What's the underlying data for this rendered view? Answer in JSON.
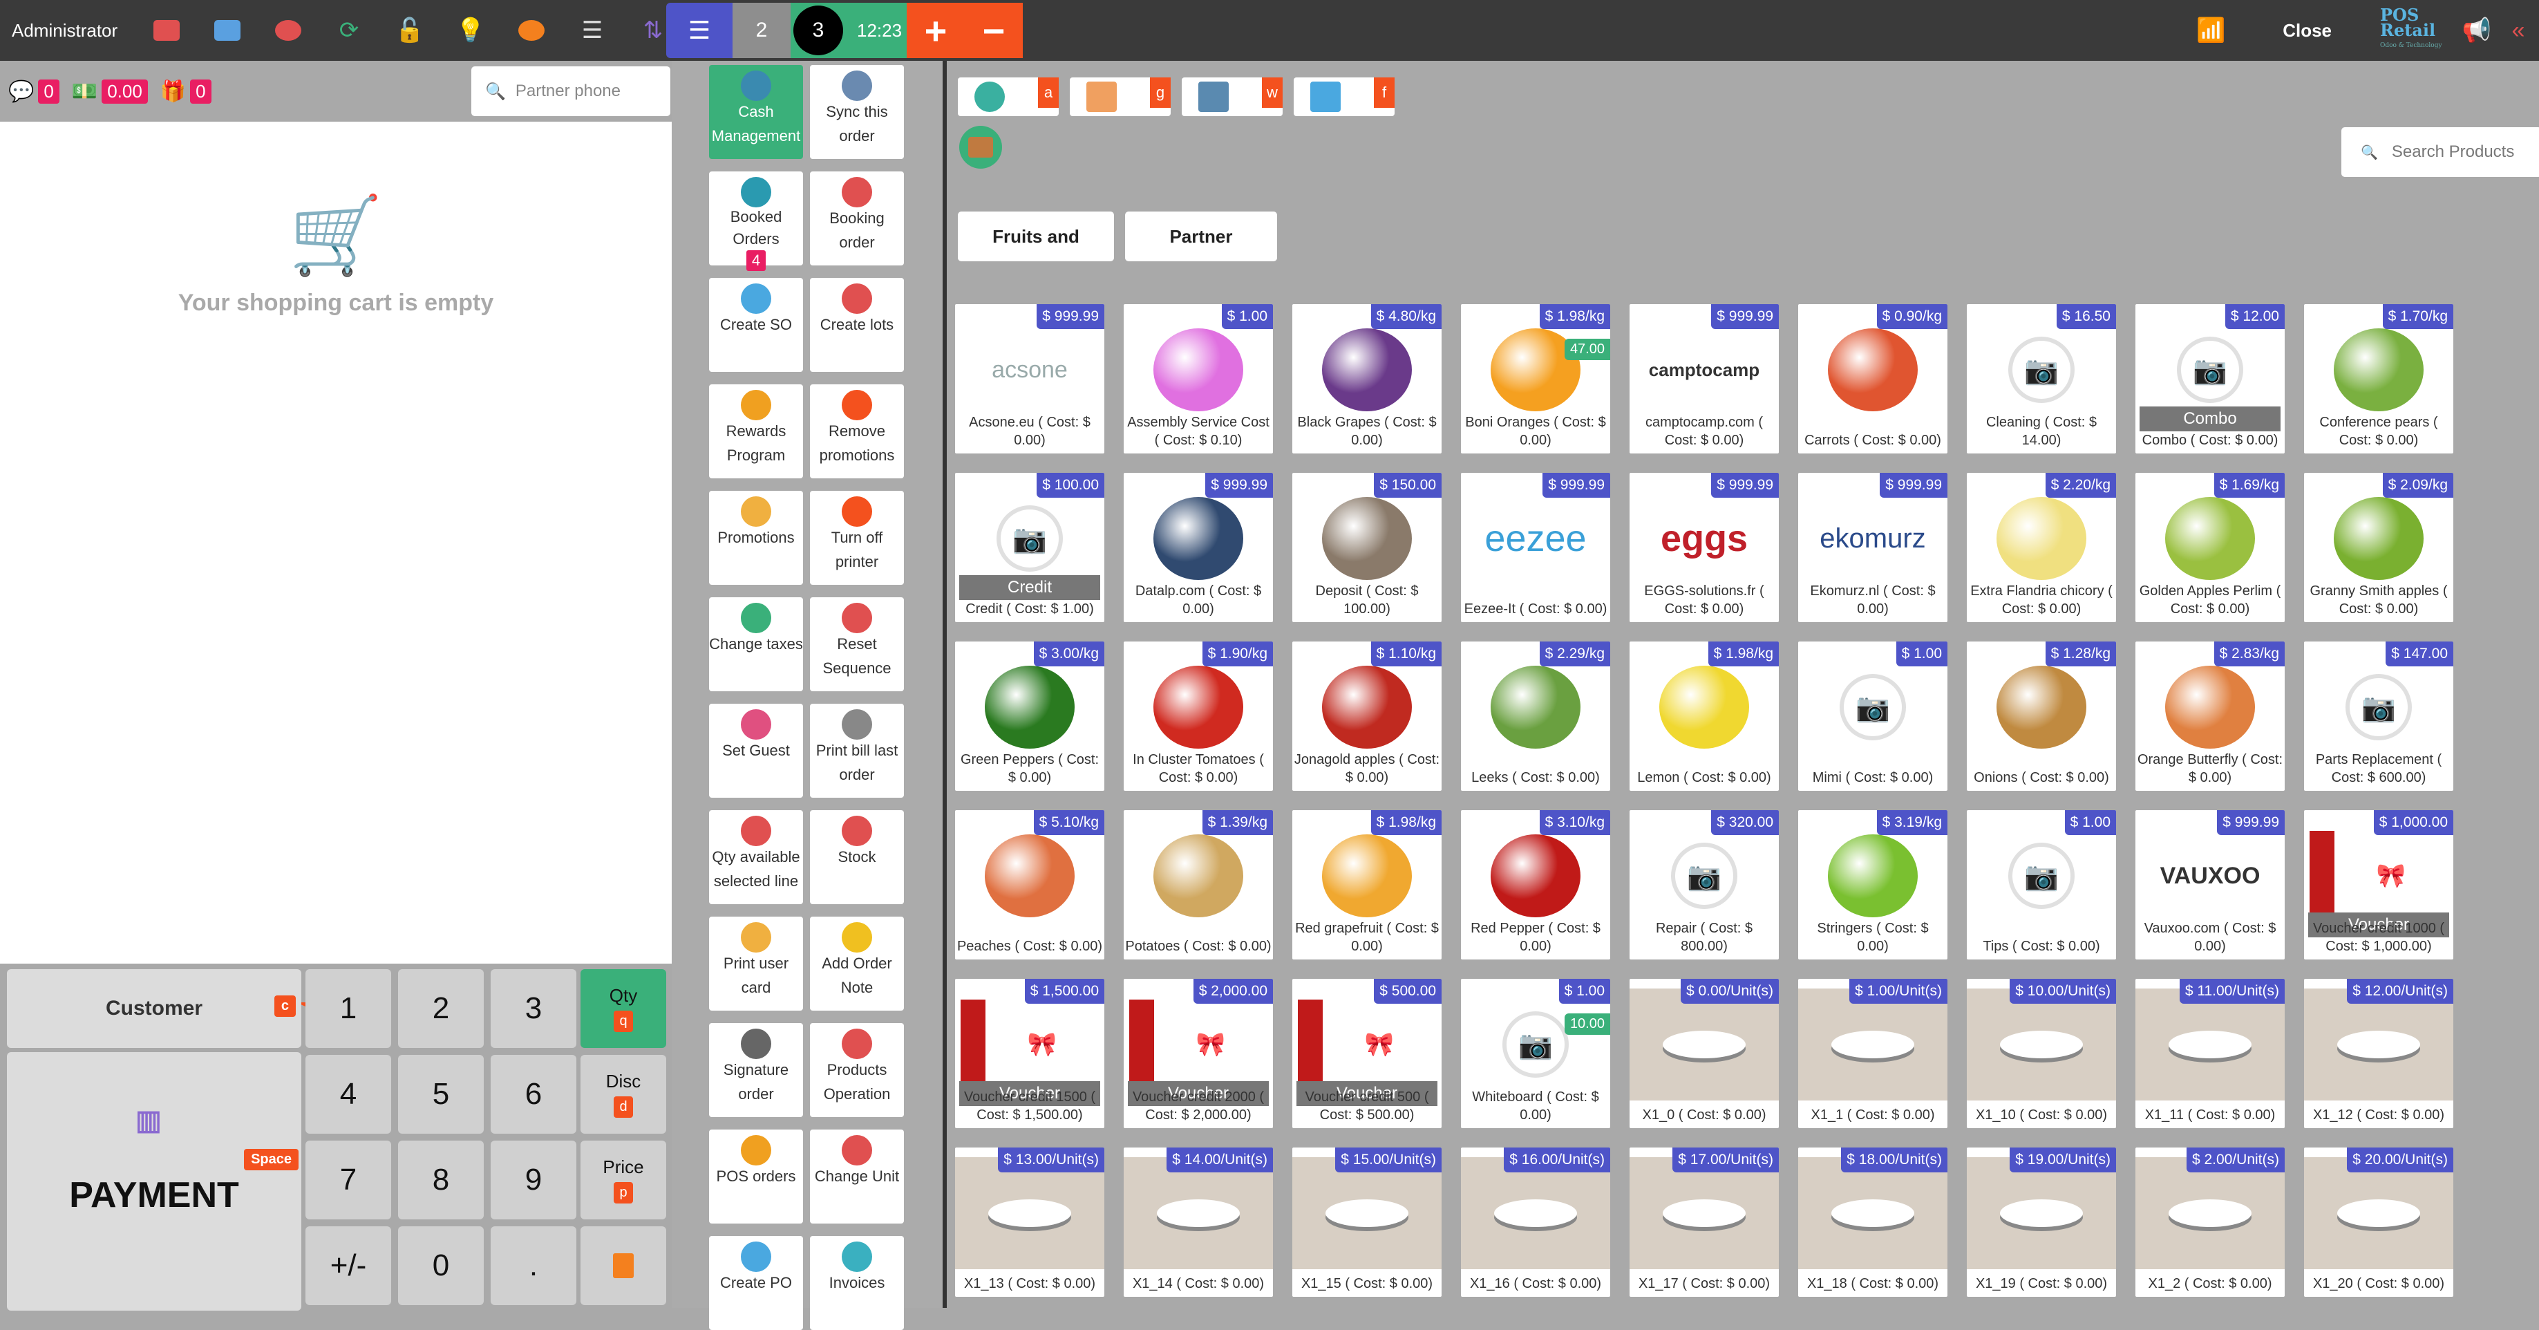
{
  "topbar": {
    "user": "Administrator",
    "orders": {
      "other": "2",
      "current": "3",
      "time": "12:23",
      "add": "+",
      "remove": "−"
    },
    "close": "Close",
    "logo": "POS Retail",
    "logo_sub": "Odoo & Technology"
  },
  "left": {
    "chat_count": "0",
    "cash": "0.00",
    "gift_count": "0",
    "partner_placeholder": "Partner phone",
    "empty_text": "Your shopping cart is empty"
  },
  "pad": {
    "customer": "Customer",
    "customer_key": "c",
    "payment": "PAYMENT",
    "payment_key": "Space",
    "keys": [
      "1",
      "2",
      "3",
      "4",
      "5",
      "6",
      "7",
      "8",
      "9",
      "+/-",
      "0",
      "."
    ],
    "qty": "Qty",
    "qty_key": "q",
    "disc": "Disc",
    "disc_key": "d",
    "price": "Price",
    "price_key": "p"
  },
  "actions": [
    {
      "label": "Cash Management",
      "name": "cash-management-button",
      "icon": "#3a8ab0"
    },
    {
      "label": "Sync this order",
      "name": "sync-order-button",
      "icon": "#6a8ab0"
    },
    {
      "label": "Booked Orders",
      "badge": "4",
      "name": "booked-orders-button",
      "icon": "#2a9ab0"
    },
    {
      "label": "Booking order",
      "name": "booking-order-button",
      "icon": "#e05050"
    },
    {
      "label": "Create SO",
      "name": "create-so-button",
      "icon": "#4aa8e0"
    },
    {
      "label": "Create lots",
      "name": "create-lots-button",
      "icon": "#e05050"
    },
    {
      "label": "Rewards Program",
      "name": "rewards-program-button",
      "icon": "#f0a020"
    },
    {
      "label": "Remove promotions",
      "name": "remove-promotions-button",
      "icon": "#f4511e"
    },
    {
      "label": "Promotions",
      "name": "promotions-button",
      "icon": "#f0b040"
    },
    {
      "label": "Turn off printer",
      "name": "turn-off-printer-button",
      "icon": "#f4511e"
    },
    {
      "label": "Change taxes",
      "name": "change-taxes-button",
      "icon": "#3ab07a"
    },
    {
      "label": "Reset Sequence",
      "name": "reset-sequence-button",
      "icon": "#e05050"
    },
    {
      "label": "Set Guest",
      "name": "set-guest-button",
      "icon": "#e05080"
    },
    {
      "label": "Print bill last order",
      "name": "print-bill-button",
      "icon": "#888888"
    },
    {
      "label": "Qty available selected line",
      "name": "qty-available-button",
      "icon": "#e05050"
    },
    {
      "label": "Stock",
      "name": "stock-button",
      "icon": "#e05050"
    },
    {
      "label": "Print user card",
      "name": "print-user-card-button",
      "icon": "#f0b040"
    },
    {
      "label": "Add Order Note",
      "name": "add-order-note-button",
      "icon": "#f0c020"
    },
    {
      "label": "Signature order",
      "name": "signature-order-button",
      "icon": "#666666"
    },
    {
      "label": "Products Operation",
      "name": "products-operation-button",
      "icon": "#e05050"
    },
    {
      "label": "POS orders",
      "name": "pos-orders-button",
      "icon": "#f0a020"
    },
    {
      "label": "Change Unit",
      "name": "change-unit-button",
      "icon": "#e05050"
    },
    {
      "label": "Create PO",
      "name": "create-po-button",
      "icon": "#4aa8e0"
    },
    {
      "label": "Invoices",
      "name": "invoices-button",
      "icon": "#3ab0c0"
    }
  ],
  "right": {
    "cat_letters": [
      "a",
      "g",
      "w",
      "f"
    ],
    "search_placeholder": "Search Products",
    "categories": [
      "Fruits and",
      "Partner"
    ]
  },
  "products": [
    {
      "price": "$ 999.99",
      "name": "Acsone.eu ( Cost: $ 0.00)",
      "img": "text:acsone"
    },
    {
      "price": "$ 1.00",
      "name": "Assembly Service Cost ( Cost: $ 0.10)",
      "img": "#e070e0"
    },
    {
      "price": "$ 4.80/kg",
      "name": "Black Grapes ( Cost: $ 0.00)",
      "img": "#6a3a8a"
    },
    {
      "price": "$ 1.98/kg",
      "stock": "47.00",
      "name": "Boni Oranges ( Cost: $ 0.00)",
      "img": "#f5a020"
    },
    {
      "price": "$ 999.99",
      "name": "camptocamp.com ( Cost: $ 0.00)",
      "img": "text:camptocamp"
    },
    {
      "price": "$ 0.90/kg",
      "name": "Carrots ( Cost: $ 0.00)",
      "img": "#e05530"
    },
    {
      "price": "$ 16.50",
      "name": "Cleaning ( Cost: $ 14.00)",
      "img": "none"
    },
    {
      "price": "$ 12.00",
      "name": "Combo ( Cost: $ 0.00)",
      "img": "none",
      "overlay": "Combo"
    },
    {
      "price": "$ 1.70/kg",
      "name": "Conference pears ( Cost: $ 0.00)",
      "img": "#7ab040"
    },
    {
      "price": "$ 100.00",
      "name": "Credit ( Cost: $ 1.00)",
      "img": "none",
      "overlay": "Credit"
    },
    {
      "price": "$ 999.99",
      "name": "Datalp.com ( Cost: $ 0.00)",
      "img": "#304a70"
    },
    {
      "price": "$ 150.00",
      "name": "Deposit ( Cost: $ 100.00)",
      "img": "#8a7a6a"
    },
    {
      "price": "$ 999.99",
      "name": "Eezee-It ( Cost: $ 0.00)",
      "img": "text:eezee"
    },
    {
      "price": "$ 999.99",
      "name": "EGGS-solutions.fr ( Cost: $ 0.00)",
      "img": "text:eggs"
    },
    {
      "price": "$ 999.99",
      "name": "Ekomurz.nl ( Cost: $ 0.00)",
      "img": "text:ekomurz"
    },
    {
      "price": "$ 2.20/kg",
      "name": "Extra Flandria chicory ( Cost: $ 0.00)",
      "img": "#f0e080"
    },
    {
      "price": "$ 1.69/kg",
      "name": "Golden Apples Perlim ( Cost: $ 0.00)",
      "img": "#9ac040"
    },
    {
      "price": "$ 2.09/kg",
      "name": "Granny Smith apples ( Cost: $ 0.00)",
      "img": "#7ab030"
    },
    {
      "price": "$ 3.00/kg",
      "name": "Green Peppers ( Cost: $ 0.00)",
      "img": "#2a7a20"
    },
    {
      "price": "$ 1.90/kg",
      "name": "In Cluster Tomatoes ( Cost: $ 0.00)",
      "img": "#d02a20"
    },
    {
      "price": "$ 1.10/kg",
      "name": "Jonagold apples ( Cost: $ 0.00)",
      "img": "#c02a20"
    },
    {
      "price": "$ 2.29/kg",
      "name": "Leeks ( Cost: $ 0.00)",
      "img": "#6aa040"
    },
    {
      "price": "$ 1.98/kg",
      "name": "Lemon ( Cost: $ 0.00)",
      "img": "#f0d830"
    },
    {
      "price": "$ 1.00",
      "name": "Mimi ( Cost: $ 0.00)",
      "img": "none"
    },
    {
      "price": "$ 1.28/kg",
      "name": "Onions ( Cost: $ 0.00)",
      "img": "#c08a40"
    },
    {
      "price": "$ 2.83/kg",
      "name": "Orange Butterfly ( Cost: $ 0.00)",
      "img": "#e08040"
    },
    {
      "price": "$ 147.00",
      "name": "Parts Replacement ( Cost: $ 600.00)",
      "img": "none"
    },
    {
      "price": "$ 5.10/kg",
      "name": "Peaches ( Cost: $ 0.00)",
      "img": "#e07040"
    },
    {
      "price": "$ 1.39/kg",
      "name": "Potatoes ( Cost: $ 0.00)",
      "img": "#d0a860"
    },
    {
      "price": "$ 1.98/kg",
      "name": "Red grapefruit ( Cost: $ 0.00)",
      "img": "#f0a830"
    },
    {
      "price": "$ 3.10/kg",
      "name": "Red Pepper ( Cost: $ 0.00)",
      "img": "#c01a18"
    },
    {
      "price": "$ 320.00",
      "name": "Repair ( Cost: $ 800.00)",
      "img": "none"
    },
    {
      "price": "$ 3.19/kg",
      "name": "Stringers ( Cost: $ 0.00)",
      "img": "#7ac030"
    },
    {
      "price": "$ 1.00",
      "name": "Tips ( Cost: $ 0.00)",
      "img": "none"
    },
    {
      "price": "$ 999.99",
      "name": "Vauxoo.com ( Cost: $ 0.00)",
      "img": "text:vauxoo"
    },
    {
      "price": "$ 1,000.00",
      "name": "Voucher credit 1000 ( Cost: $ 1,000.00)",
      "img": "gift",
      "overlay": "Voucher"
    },
    {
      "price": "$ 1,500.00",
      "name": "Voucher credit 1500 ( Cost: $ 1,500.00)",
      "img": "gift",
      "overlay": "Voucher"
    },
    {
      "price": "$ 2,000.00",
      "name": "Voucher credit 2000 ( Cost: $ 2,000.00)",
      "img": "gift",
      "overlay": "Voucher"
    },
    {
      "price": "$ 500.00",
      "name": "Voucher credit 500 ( Cost: $ 500.00)",
      "img": "gift",
      "overlay": "Voucher"
    },
    {
      "price": "$ 1.00",
      "stock": "10.00",
      "name": "Whiteboard ( Cost: $ 0.00)",
      "img": "none"
    },
    {
      "price": "$ 0.00/Unit(s)",
      "name": "X1_0 ( Cost: $ 0.00)",
      "img": "robot"
    },
    {
      "price": "$ 1.00/Unit(s)",
      "name": "X1_1 ( Cost: $ 0.00)",
      "img": "robot"
    },
    {
      "price": "$ 10.00/Unit(s)",
      "name": "X1_10 ( Cost: $ 0.00)",
      "img": "robot"
    },
    {
      "price": "$ 11.00/Unit(s)",
      "name": "X1_11 ( Cost: $ 0.00)",
      "img": "robot"
    },
    {
      "price": "$ 12.00/Unit(s)",
      "name": "X1_12 ( Cost: $ 0.00)",
      "img": "robot"
    },
    {
      "price": "$ 13.00/Unit(s)",
      "name": "X1_13 ( Cost: $ 0.00)",
      "img": "robot"
    },
    {
      "price": "$ 14.00/Unit(s)",
      "name": "X1_14 ( Cost: $ 0.00)",
      "img": "robot"
    },
    {
      "price": "$ 15.00/Unit(s)",
      "name": "X1_15 ( Cost: $ 0.00)",
      "img": "robot"
    },
    {
      "price": "$ 16.00/Unit(s)",
      "name": "X1_16 ( Cost: $ 0.00)",
      "img": "robot"
    },
    {
      "price": "$ 17.00/Unit(s)",
      "name": "X1_17 ( Cost: $ 0.00)",
      "img": "robot"
    },
    {
      "price": "$ 18.00/Unit(s)",
      "name": "X1_18 ( Cost: $ 0.00)",
      "img": "robot"
    },
    {
      "price": "$ 19.00/Unit(s)",
      "name": "X1_19 ( Cost: $ 0.00)",
      "img": "robot"
    },
    {
      "price": "$ 2.00/Unit(s)",
      "name": "X1_2 ( Cost: $ 0.00)",
      "img": "robot"
    },
    {
      "price": "$ 20.00/Unit(s)",
      "name": "X1_20 ( Cost: $ 0.00)",
      "img": "robot"
    }
  ]
}
